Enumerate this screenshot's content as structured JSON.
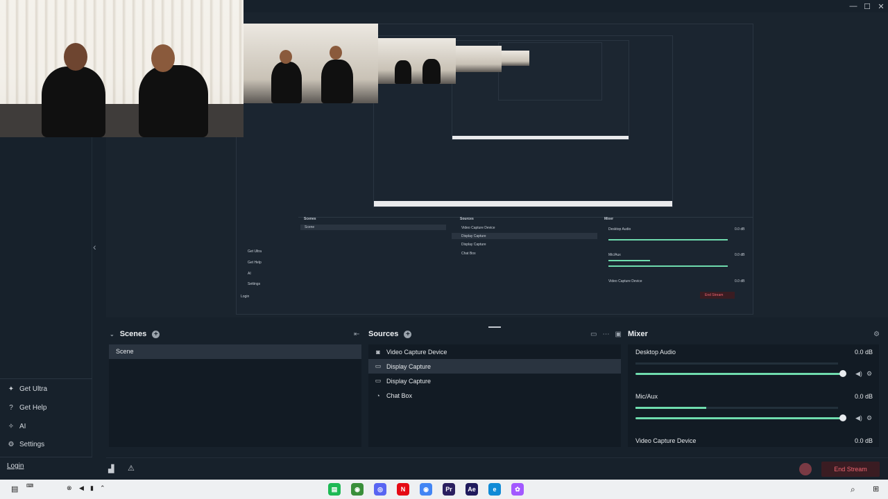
{
  "window_controls": [
    "—",
    "☐",
    "✕"
  ],
  "sidebar": {
    "items": [
      {
        "label": "Get Ultra",
        "icon": "ultra-icon"
      },
      {
        "label": "Get Help",
        "icon": "help-icon"
      },
      {
        "label": "AI",
        "icon": "ai-icon"
      },
      {
        "label": "Settings",
        "icon": "gear-icon"
      }
    ],
    "login": "Login"
  },
  "scenes": {
    "title": "Scenes",
    "items": [
      "Scene"
    ]
  },
  "sources": {
    "title": "Sources",
    "items": [
      {
        "label": "Video Capture Device",
        "icon": "camera-icon",
        "selected": false
      },
      {
        "label": "Display Capture",
        "icon": "monitor-icon",
        "selected": true
      },
      {
        "label": "Display Capture",
        "icon": "monitor-icon",
        "selected": false
      },
      {
        "label": "Chat Box",
        "icon": "chat-icon",
        "selected": false
      }
    ]
  },
  "mixer": {
    "title": "Mixer",
    "channels": [
      {
        "name": "Desktop Audio",
        "db": "0.0 dB",
        "level": 0.0
      },
      {
        "name": "Mic/Aux",
        "db": "0.0 dB",
        "level": 0.35
      },
      {
        "name": "Video Capture Device",
        "db": "0.0 dB",
        "level": 0.0
      }
    ]
  },
  "status": {
    "end_stream": "End Stream"
  },
  "preview_mini": {
    "scenes": "Scenes",
    "sources": "Sources",
    "mixer": "Mixer",
    "scene": "Scene",
    "src1": "Video Capture Device",
    "src2": "Display Capture",
    "src3": "Display Capture",
    "src4": "Chat Box",
    "mix1": "Desktop Audio",
    "mix2": "Mic/Aux",
    "mix3": "Video Capture Device",
    "db": "0.0 dB",
    "get_ultra": "Get Ultra",
    "get_help": "Get Help",
    "ai": "AI",
    "settings": "Settings",
    "login": "Login",
    "end_stream": "End Stream"
  },
  "taskbar": {
    "apps": [
      {
        "name": "app-icon",
        "color": "#1db954",
        "glyph": "▤"
      },
      {
        "name": "chrome-icon",
        "color": "#3a8f3a",
        "glyph": "◉"
      },
      {
        "name": "discord-icon",
        "color": "#5865f2",
        "glyph": "◎"
      },
      {
        "name": "netflix-icon",
        "color": "#e50914",
        "glyph": "N"
      },
      {
        "name": "chrome-icon-2",
        "color": "#4285f4",
        "glyph": "◉"
      },
      {
        "name": "premiere-icon",
        "color": "#2a1f5f",
        "glyph": "Pr"
      },
      {
        "name": "aftereffects-icon",
        "color": "#1f1a5c",
        "glyph": "Ae"
      },
      {
        "name": "edge-icon",
        "color": "#0f8ad6",
        "glyph": "e"
      },
      {
        "name": "figma-icon",
        "color": "#a259ff",
        "glyph": "✿"
      }
    ]
  },
  "colors": {
    "accent": "#6fdcae",
    "end_stream": "#f06470",
    "background": "#17212b"
  }
}
